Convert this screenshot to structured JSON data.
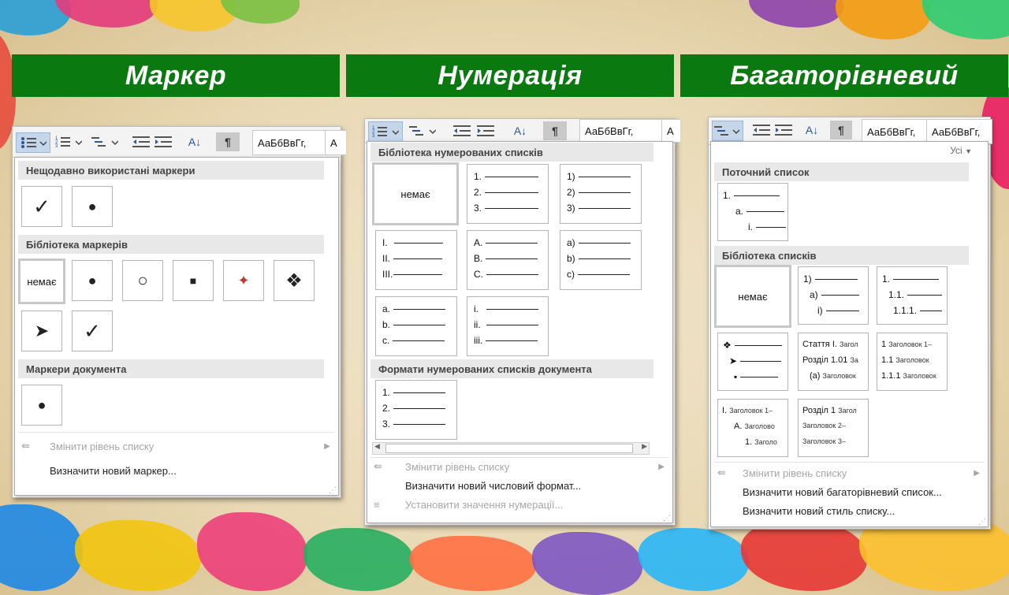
{
  "headers": [
    "Маркер",
    "Нумерація",
    "Багаторівневий"
  ],
  "ribbon": {
    "style_sample": "АаБбВвГг,",
    "style_sample_short": "А",
    "sort_glyph": "A↓",
    "pilcrow": "¶"
  },
  "bullets": {
    "recent_header": "Нещодавно використані маркери",
    "library_header": "Бібліотека маркерів",
    "document_header": "Маркери документа",
    "none_label": "немає",
    "recent": [
      "✓",
      "●"
    ],
    "library": [
      "○",
      "■",
      "✦",
      "❖",
      "➤",
      "✓"
    ],
    "document": [
      "●"
    ],
    "change_level": "Змінити рівень списку",
    "define_new": "Визначити новий маркер..."
  },
  "numbering": {
    "library_header": "Бібліотека нумерованих списків",
    "doc_formats_header": "Формати нумерованих списків документа",
    "none_label": "немає",
    "formats": [
      [
        "1.",
        "2.",
        "3."
      ],
      [
        "1)",
        "2)",
        "3)"
      ],
      [
        "I.",
        "II.",
        "III."
      ],
      [
        "A.",
        "B.",
        "C."
      ],
      [
        "a)",
        "b)",
        "c)"
      ],
      [
        "a.",
        "b.",
        "c."
      ],
      [
        "i.",
        "ii.",
        "iii."
      ]
    ],
    "doc_format": [
      "1.",
      "2.",
      "3."
    ],
    "change_level": "Змінити рівень списку",
    "define_new": "Визначити новий числовий формат...",
    "set_value": "Установити значення нумерації..."
  },
  "multilevel": {
    "filter": "Усі",
    "current_header": "Поточний список",
    "library_header": "Бібліотека списків",
    "none_label": "немає",
    "current": [
      "1.",
      "a.",
      "i."
    ],
    "tile_a": [
      "1)",
      "a)",
      "i)"
    ],
    "tile_b": [
      "1.",
      "1.1.",
      "1.1.1."
    ],
    "tile_c": [
      "❖",
      "➤",
      "▪"
    ],
    "tile_d": [
      {
        "main": "Стаття I.",
        "tail": "Загол"
      },
      {
        "main": "Розділ 1.01",
        "tail": "За"
      },
      {
        "main": "(a)",
        "tail": "Заголовок"
      }
    ],
    "tile_e": [
      {
        "main": "1",
        "tail": "Заголовок 1–"
      },
      {
        "main": "1.1",
        "tail": "Заголовок"
      },
      {
        "main": "1.1.1",
        "tail": "Заголовок"
      }
    ],
    "tile_f": [
      {
        "main": "I.",
        "tail": "Заголовок 1–"
      },
      {
        "main": "A.",
        "tail": "Заголово"
      },
      {
        "main": "1.",
        "tail": "Заголо"
      }
    ],
    "tile_g": [
      {
        "main": "Розділ 1",
        "tail": "Загол"
      },
      {
        "main": "",
        "tail": "Заголовок 2–"
      },
      {
        "main": "",
        "tail": "Заголовок 3–"
      }
    ],
    "change_level": "Змінити рівень списку",
    "define_new_list": "Визначити новий багаторівневий список...",
    "define_new_style": "Визначити новий стиль списку..."
  }
}
